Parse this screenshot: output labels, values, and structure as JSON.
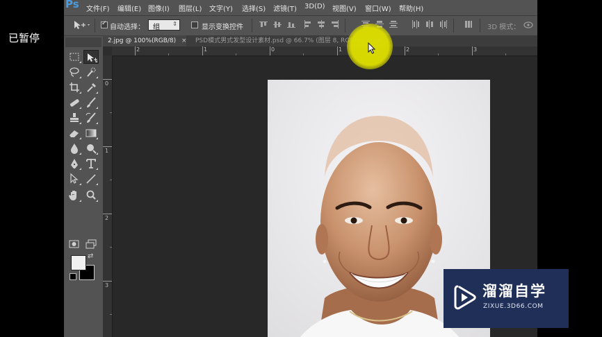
{
  "overlay": {
    "paused": "已暂停"
  },
  "app": {
    "logo": "Ps"
  },
  "menubar": {
    "items": [
      "文件(F)",
      "编辑(E)",
      "图像(I)",
      "图层(L)",
      "文字(Y)",
      "选择(S)",
      "滤镜(T)",
      "3D(D)",
      "视图(V)",
      "窗口(W)",
      "帮助(H)"
    ]
  },
  "options": {
    "auto_select_label": "自动选择：",
    "auto_select_checked": true,
    "auto_select_value": "组",
    "show_transform_label": "显示变换控件",
    "show_transform_checked": false,
    "mode_3d_label": "3D 模式："
  },
  "tabs": [
    {
      "label": "2.jpg @ 100%(RGB/8)",
      "close": "×",
      "active": true
    },
    {
      "label": "PSD模式男式发型设计素材.psd @ 66.7% (图层 8, RGB/8)",
      "close": "×",
      "active": false
    }
  ],
  "rulers": {
    "h_labels": [
      "2",
      "1",
      "0",
      "1",
      "2",
      "3"
    ],
    "v_labels": [
      "0",
      "1",
      "2",
      "3"
    ]
  },
  "tools": [
    "marquee-icon",
    "move-icon",
    "lasso-icon",
    "quick-select-icon",
    "crop-icon",
    "eyedropper-icon",
    "healing-brush-icon",
    "brush-icon",
    "clone-stamp-icon",
    "history-brush-icon",
    "eraser-icon",
    "gradient-icon",
    "blur-icon",
    "dodge-icon",
    "pen-icon",
    "type-icon",
    "path-select-icon",
    "line-icon",
    "hand-icon",
    "zoom-icon"
  ],
  "colors": {
    "accent": "#4a9cde",
    "foreground": "#f0f0f0",
    "background": "#000000",
    "highlight": "#dede00",
    "watermark_bg": "#1f2f57"
  },
  "watermark": {
    "title": "溜溜自学",
    "subtitle": "ZIXUE.3D66.COM"
  }
}
